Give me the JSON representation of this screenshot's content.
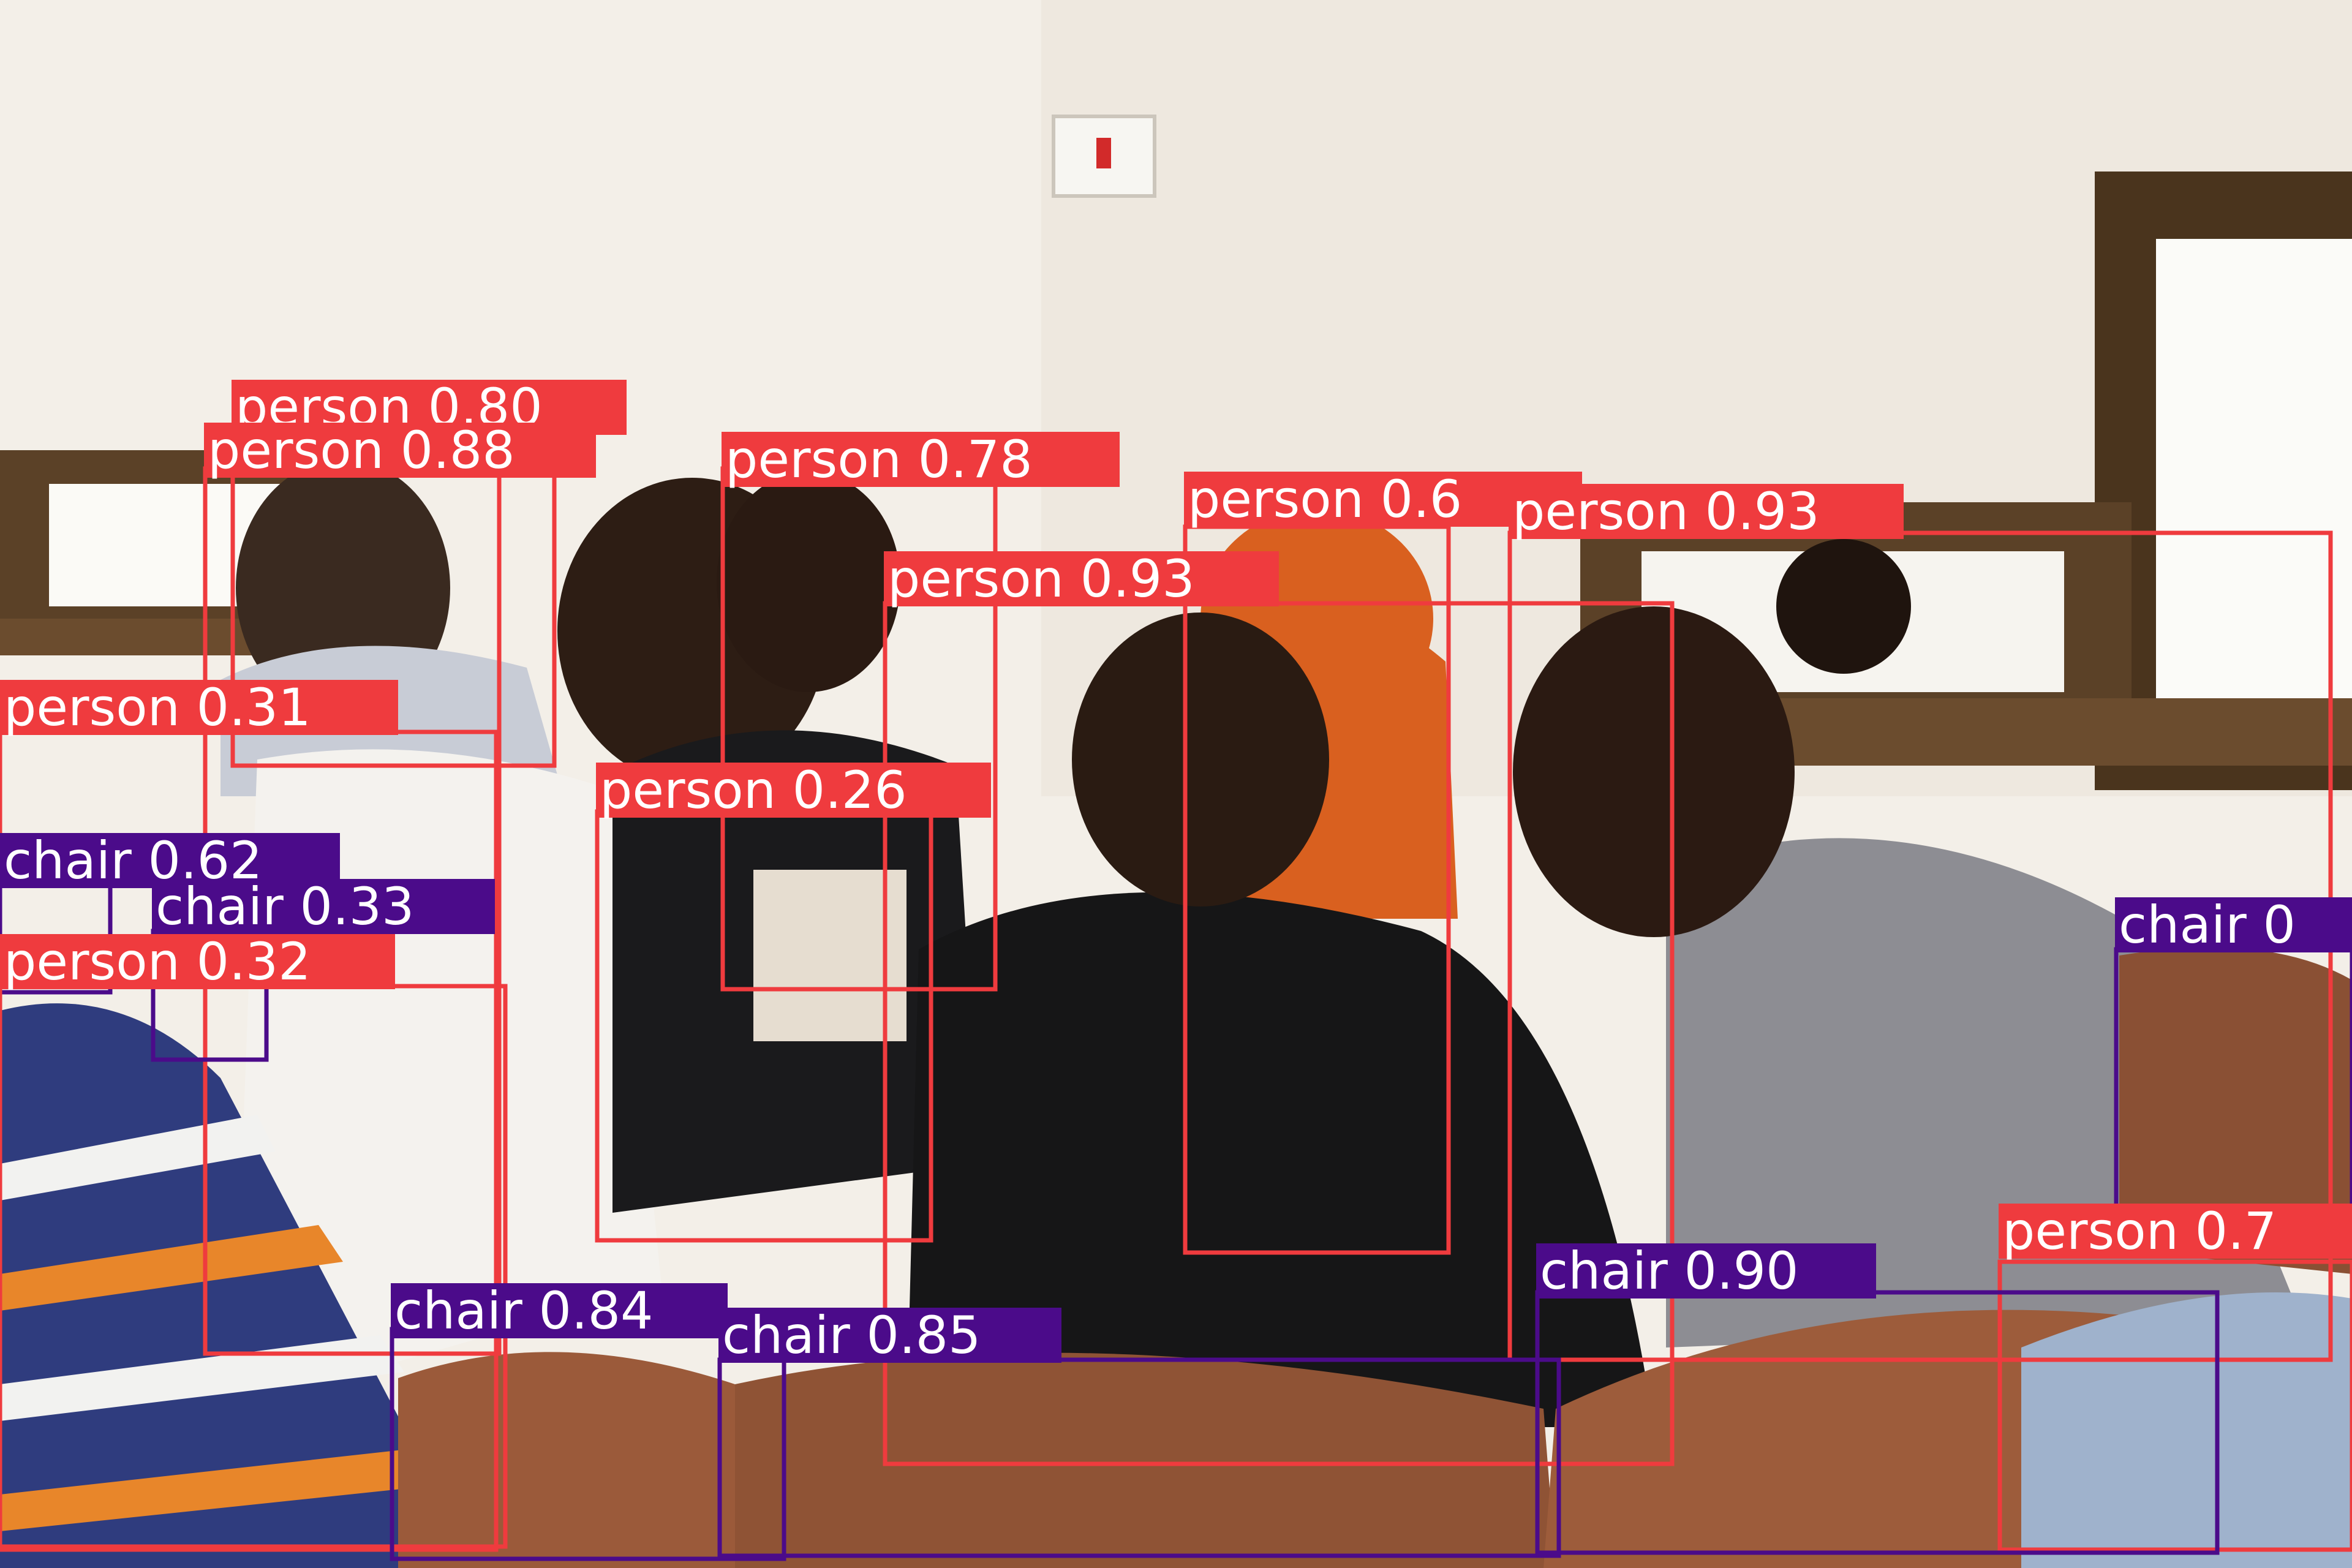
{
  "colors": {
    "person": "#ef3b3e",
    "chair": "#4b0b8a",
    "label_text": "#ffffff",
    "wall": "#f3efe8",
    "wood": "#5a3d22",
    "chair_seat": "#9b5a3a"
  },
  "detections": [
    {
      "label": "person 0.80",
      "class": "person"
    },
    {
      "label": "person 0.88",
      "class": "person"
    },
    {
      "label": "person 0.78",
      "class": "person"
    },
    {
      "label": "person 0.6",
      "class": "person"
    },
    {
      "label": "person 0.93",
      "class": "person"
    },
    {
      "label": "person 0.93",
      "class": "person"
    },
    {
      "label": "person 0.31",
      "class": "person"
    },
    {
      "label": "person 0.26",
      "class": "person"
    },
    {
      "label": "chair 0.62",
      "class": "chair"
    },
    {
      "label": "chair 0.33",
      "class": "chair"
    },
    {
      "label": "person 0.32",
      "class": "person"
    },
    {
      "label": "chair 0",
      "class": "chair"
    },
    {
      "label": "person 0.7",
      "class": "person"
    },
    {
      "label": "chair 0.90",
      "class": "chair"
    },
    {
      "label": "chair 0.84",
      "class": "chair"
    },
    {
      "label": "chair 0.85",
      "class": "chair"
    }
  ]
}
